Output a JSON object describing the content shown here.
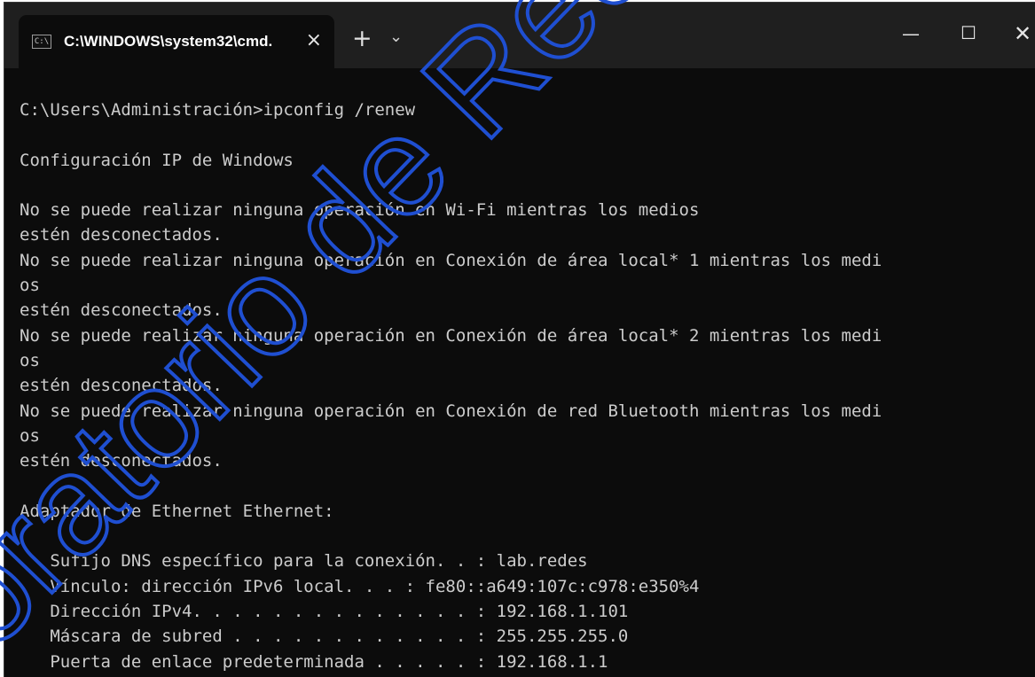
{
  "window": {
    "tab_title": "C:\\WINDOWS\\system32\\cmd.",
    "tab_icon_text": "C:\\",
    "tab_close_glyph": "×",
    "new_tab_glyph": "+",
    "dropdown_glyph": "⌄",
    "minimize_glyph": "—",
    "maximize_glyph": "☐",
    "close_glyph": "✕"
  },
  "console": {
    "lines": [
      "C:\\Users\\Administración>ipconfig /renew",
      "",
      "Configuración IP de Windows",
      "",
      "No se puede realizar ninguna operación en Wi-Fi mientras los medios",
      "estén desconectados.",
      "No se puede realizar ninguna operación en Conexión de área local* 1 mientras los medi",
      "os",
      "estén desconectados.",
      "No se puede realizar ninguna operación en Conexión de área local* 2 mientras los medi",
      "os",
      "estén desconectados.",
      "No se puede realizar ninguna operación en Conexión de red Bluetooth mientras los medi",
      "os",
      "estén desconectados.",
      "",
      "Adaptador de Ethernet Ethernet:",
      "",
      "   Sufijo DNS específico para la conexión. . : lab.redes",
      "   Vínculo: dirección IPv6 local. . . : fe80::a649:107c:c978:e350%4",
      "   Dirección IPv4. . . . . . . . . . . . . . : 192.168.1.101",
      "   Máscara de subred . . . . . . . . . . . . : 255.255.255.0",
      "   Puerta de enlace predeterminada . . . . . : 192.168.1.1"
    ]
  },
  "watermark": {
    "text": "oratorio de Redes",
    "color": "#1f4fd1"
  }
}
